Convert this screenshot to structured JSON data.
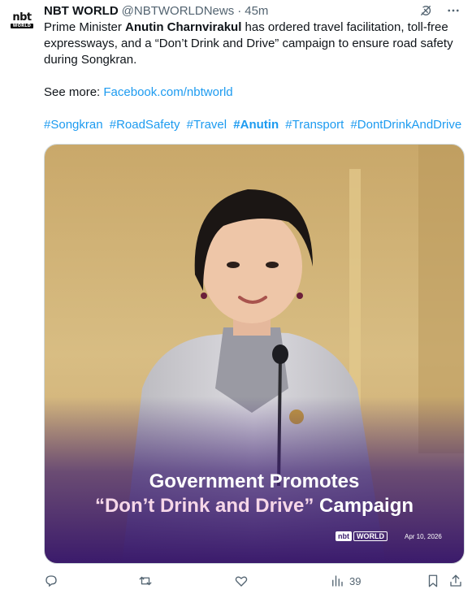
{
  "post": {
    "author_name": "NBT WORLD",
    "author_handle": "@NBTWORLDNews",
    "separator": "·",
    "time": "45m",
    "avatar": {
      "top": "nbt",
      "bottom": "WORLD"
    },
    "text_pre": "Prime Minister ",
    "text_bold": "Anutin Charnvirakul",
    "text_post": " has ordered travel facilitation, toll-free expressways, and a “Don’t Drink and Drive” campaign to ensure road safety during Songkran.",
    "see_more_label": "See more: ",
    "see_more_link": "Facebook.com/nbtworld",
    "hashtags": [
      "#Songkran",
      "#RoadSafety",
      "#Travel",
      "#Anutin",
      "#Transport",
      "#DontDrinkAndDrive"
    ],
    "bold_hashtag_index": 3
  },
  "media": {
    "caption_line1": "Government Promotes",
    "caption_quote": "“Don’t Drink and Drive”",
    "caption_word": " Campaign",
    "brand_nbt": "nbt",
    "brand_world": "WORLD",
    "date": "Apr 10, 2026"
  },
  "actions": {
    "views_count": "39",
    "icons": [
      "reply-icon",
      "repost-icon",
      "like-icon",
      "views-icon",
      "bookmark-icon",
      "share-icon"
    ]
  },
  "header_icons": [
    "grok-icon",
    "more-icon"
  ],
  "colors": {
    "link": "#1d9bf0",
    "text": "#0f1419",
    "muted": "#536471"
  }
}
